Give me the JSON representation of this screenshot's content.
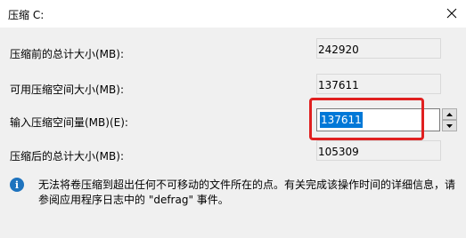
{
  "window": {
    "title": "压缩 C:"
  },
  "rows": {
    "total_before_label": "压缩前的总计大小(MB):",
    "total_before_value": "242920",
    "available_label": "可用压缩空间大小(MB):",
    "available_value": "137611",
    "input_label": "输入压缩空间量(MB)(E):",
    "input_value": "137611",
    "total_after_label": "压缩后的总计大小(MB):",
    "total_after_value": "105309"
  },
  "info": {
    "text": "无法将卷压缩到超出任何不可移动的文件所在的点。有关完成该操作时间的详细信息，请参阅应用程序日志中的 \"defrag\" 事件。"
  },
  "colors": {
    "highlight": "#e02020",
    "selection": "#0078d7",
    "info_icon": "#1e73be"
  }
}
